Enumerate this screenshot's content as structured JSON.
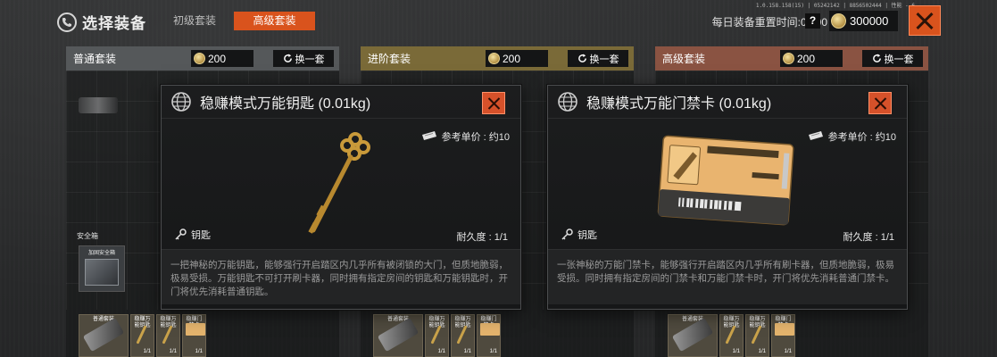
{
  "build_info": "1.0.158.158(15) | 05242142 | 8856502444 | 性能 - 6",
  "header": {
    "title": "选择装备",
    "tabs": [
      {
        "label": "初级套装",
        "active": false
      },
      {
        "label": "高级套装",
        "active": true
      }
    ],
    "reset_label": "每日装备重置时间:05:00",
    "help_label": "?",
    "balance": "300000"
  },
  "columns": [
    {
      "title": "普通套装",
      "price": "200",
      "swap_label": "换一套",
      "color": "#55585a"
    },
    {
      "title": "进阶套装",
      "price": "200",
      "swap_label": "换一套",
      "color": "#7a6a38"
    },
    {
      "title": "高级套装",
      "price": "200",
      "swap_label": "换一套",
      "color": "#8a5342"
    }
  ],
  "safe_box": {
    "label": "安全箱",
    "item_name": "加固安全箱"
  },
  "slots": [
    {
      "name": "普通套装",
      "count": ""
    },
    {
      "name": "稳赚万能钥匙",
      "count": "1/1"
    },
    {
      "name": "稳赚万能钥匙",
      "count": "1/1"
    },
    {
      "name": "稳赚门禁卡",
      "count": "1/1"
    }
  ],
  "modals": [
    {
      "title": "稳赚模式万能钥匙 (0.01kg)",
      "ref_price_label": "参考单价 : 约10",
      "type_label": "钥匙",
      "durability": "耐久度 : 1/1",
      "description": "一把神秘的万能钥匙，能够强行开启踏区内几乎所有被闭锁的大门，但质地脆弱，极易受损。万能钥匙不可打开刷卡器，同时拥有指定房间的钥匙和万能钥匙时，开门将优先消耗普通钥匙。",
      "art_icon": "golden-key"
    },
    {
      "title": "稳赚模式万能门禁卡 (0.01kg)",
      "ref_price_label": "参考单价 : 约10",
      "type_label": "钥匙",
      "durability": "耐久度 : 1/1",
      "description": "一张神秘的万能门禁卡，能够强行开启踏区内几乎所有刷卡器，但质地脆弱，极易受损。同时拥有指定房间的门禁卡和万能门禁卡时，开门将优先消耗普通门禁卡。",
      "art_icon": "access-card"
    }
  ],
  "colors": {
    "accent": "#d9531d",
    "panel": "#1c1d1e"
  }
}
